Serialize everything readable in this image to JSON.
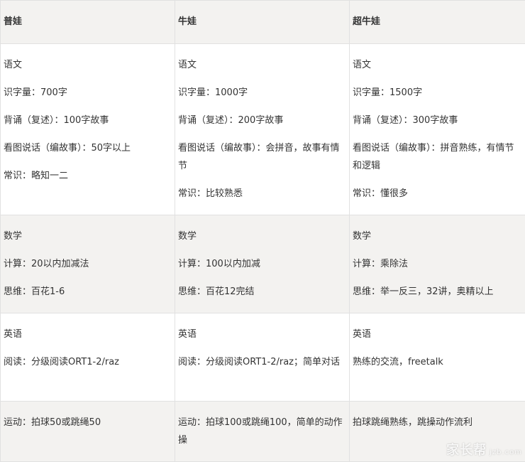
{
  "headers": [
    "普娃",
    "牛娃",
    "超牛娃"
  ],
  "rows": [
    {
      "cells": [
        [
          "语文",
          "识字量：700字",
          "背诵（复述）：100字故事",
          "看图说话（编故事）：50字以上",
          "常识：略知一二"
        ],
        [
          "语文",
          "识字量：1000字",
          "背诵（复述）：200字故事",
          "看图说话（编故事）：会拼音，故事有情节",
          "常识：比较熟悉"
        ],
        [
          "语文",
          "识字量：1500字",
          "背诵（复述）：300字故事",
          "看图说话（编故事）：拼音熟练，有情节和逻辑",
          "常识：懂很多"
        ]
      ]
    },
    {
      "cells": [
        [
          "数学",
          "计算：20以内加减法",
          "思维：百花1-6"
        ],
        [
          "数学",
          "计算：100以内加减",
          "思维：百花12完结"
        ],
        [
          "数学",
          "计算：乘除法",
          "思维：举一反三，32讲，奥精以上"
        ]
      ]
    },
    {
      "cells": [
        [
          "英语",
          "阅读：分级阅读ORT1-2/raz"
        ],
        [
          "英语",
          "阅读：分级阅读ORT1-2/raz；简单对话"
        ],
        [
          "英语",
          "熟练的交流，freetalk"
        ]
      ]
    },
    {
      "cells": [
        [
          "运动：拍球50或跳绳50"
        ],
        [
          "运动：拍球100或跳绳100，简单的动作操"
        ],
        [
          "拍球跳绳熟练，跳操动作流利"
        ]
      ]
    }
  ],
  "watermark": {
    "brand": "家长帮",
    "site": "jzb.com"
  }
}
